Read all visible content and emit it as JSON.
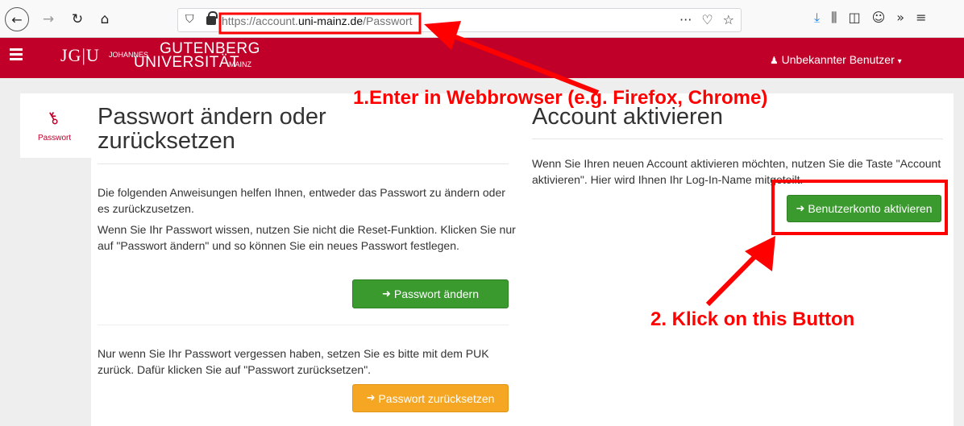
{
  "browser": {
    "url_prefix": "https://account.",
    "url_domain": "uni-mainz.de",
    "url_path": "/Passwort",
    "page_actions_icon": "ellipsis-icon",
    "pocket_icon": "pocket-icon",
    "bookmark_icon": "star-icon"
  },
  "header": {
    "logo_mark": "JG|U",
    "logo_johannes": "JOHANNES",
    "logo_gutenberg": "GUTENBERG",
    "logo_universitat": "UNIVERSITÄT",
    "logo_mainz": "MAINZ",
    "user_label": "Unbekannter Benutzer"
  },
  "sidebar": {
    "label": "Passwort",
    "icon": "key-icon"
  },
  "left": {
    "heading": "Passwort ändern oder zurücksetzen",
    "para1": "Die folgenden Anweisungen helfen Ihnen, entweder das Passwort zu ändern oder es zurückzusetzen.",
    "para2": "Wenn Sie Ihr Passwort wissen, nutzen Sie nicht die Reset-Funktion. Klicken Sie nur auf \"Passwort ändern\" und so können Sie ein neues Passwort festlegen.",
    "change_button": "Passwort ändern",
    "para3": "Nur wenn Sie Ihr Passwort vergessen haben, setzen Sie es bitte mit dem PUK zurück. Dafür klicken Sie auf \"Passwort zurücksetzen\".",
    "reset_button": "Passwort zurücksetzen"
  },
  "right": {
    "heading": "Account aktivieren",
    "para": "Wenn Sie Ihren neuen Account aktivieren möchten, nutzen Sie die Taste \"Account aktivieren\". Hier wird Ihnen Ihr Log-In-Name mitgeteilt.",
    "activate_button": "Benutzerkonto aktivieren"
  },
  "annotations": {
    "step1": "1.Enter in Webbrowser (e.g. Firefox, Chrome)",
    "step2": "2. Klick on this Button",
    "color": "#ff0000"
  },
  "colors": {
    "brand": "#c1002a",
    "green_button": "#3a9a2e",
    "orange_button": "#f5a623"
  }
}
